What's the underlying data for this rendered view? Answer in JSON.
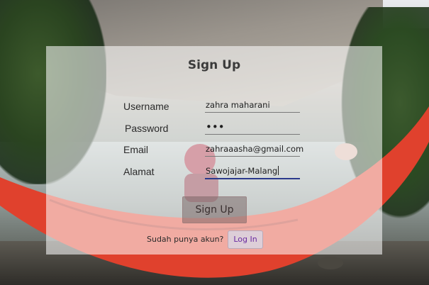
{
  "form": {
    "title": "Sign Up",
    "username": {
      "label": "Username",
      "value": "zahra maharani"
    },
    "password": {
      "label": "Password",
      "value": "•••"
    },
    "email": {
      "label": "Email",
      "value": "zahraaasha@gmail.com"
    },
    "alamat": {
      "label": "Alamat",
      "value": "Sawojajar-Malang"
    },
    "signup_button": "Sign Up",
    "login_question": "Sudah punya akun?",
    "login_button": "Log In"
  },
  "colors": {
    "panel": "#ffffff",
    "active_underline": "#2b3a8c",
    "login_text": "#6a2aa0",
    "hammock": "#e0412d"
  }
}
